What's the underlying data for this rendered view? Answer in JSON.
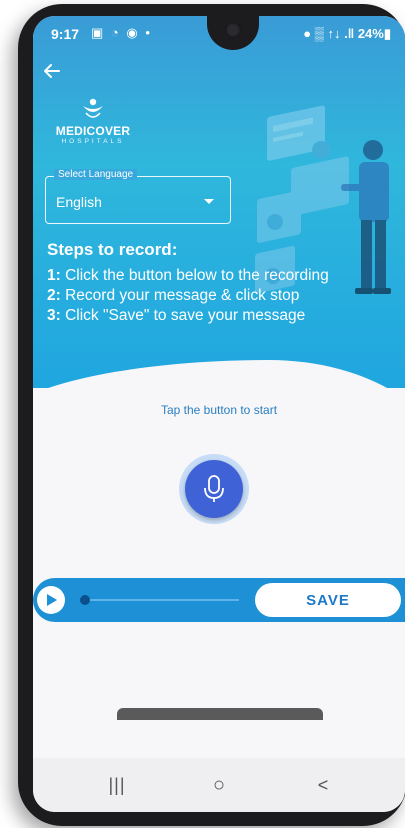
{
  "status_bar": {
    "time": "9:17",
    "icons_left": "▣ ◔ ◉ •",
    "icons_right": "● ▒ ↑↓ .‖ 24%▮"
  },
  "header": {
    "back_icon": "arrow-left-icon",
    "logo_text": "MEDICOVER",
    "logo_sub": "HOSPITALS"
  },
  "language_select": {
    "label": "Select Language",
    "value": "English"
  },
  "steps": {
    "title": "Steps to record:",
    "items": [
      {
        "num": "1:",
        "text": " Click the button below to the recording"
      },
      {
        "num": "2:",
        "text": " Record your message & click stop"
      },
      {
        "num": "3:",
        "text": " Click \"Save\" to save your message"
      }
    ]
  },
  "recorder": {
    "hint": "Tap the button to start",
    "mic_icon": "microphone-icon"
  },
  "player": {
    "play_icon": "play-icon",
    "save_label": "SAVE",
    "progress": 0
  },
  "nav": {
    "recent": "|||",
    "home": "○",
    "back": "<"
  },
  "colors": {
    "header_blue": "#2fb7dc",
    "player_blue": "#1e90d6",
    "mic_blue": "#3f63d6"
  }
}
